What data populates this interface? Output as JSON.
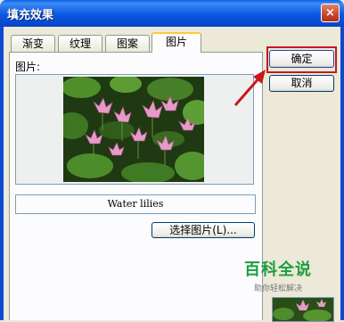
{
  "window": {
    "title": "填充效果",
    "close_glyph": "×"
  },
  "tabs": [
    {
      "label": "渐变",
      "active": false
    },
    {
      "label": "纹理",
      "active": false
    },
    {
      "label": "图案",
      "active": false
    },
    {
      "label": "图片",
      "active": true
    }
  ],
  "picture_panel": {
    "label": "图片:",
    "picture_name": "Water lilies",
    "select_button": "选择图片(L)..."
  },
  "buttons": {
    "ok": "确定",
    "cancel": "取消"
  },
  "watermark": {
    "main": "百科全说",
    "sub": "助你轻松解决"
  },
  "colors": {
    "title_bar": "#0b57e0",
    "dialog_bg": "#ece9d8",
    "highlight": "#c8181c",
    "watermark": "#1a9e3f"
  },
  "icons": [
    "close-icon",
    "red-arrow-icon"
  ]
}
